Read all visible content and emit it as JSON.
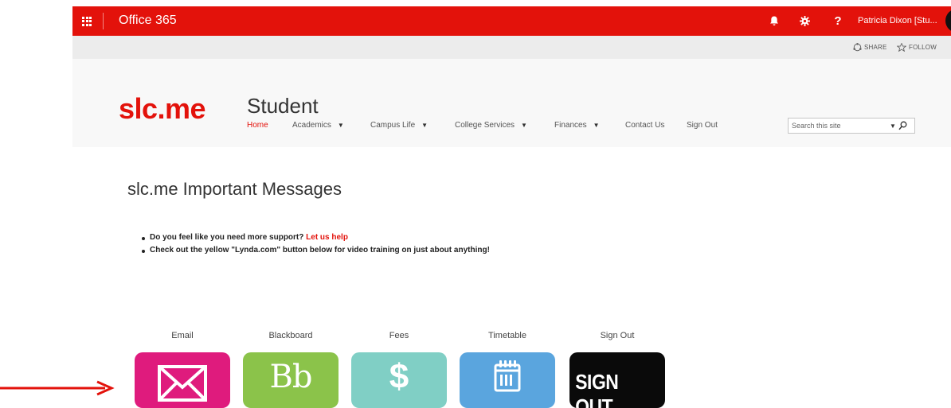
{
  "suite_bar": {
    "title": "Office 365",
    "user_name": "Patricia Dixon [Stu...",
    "help_glyph": "?"
  },
  "actions": {
    "share": "SHARE",
    "follow": "FOLLOW"
  },
  "site": {
    "logo": "slc.me",
    "title": "Student",
    "nav": [
      {
        "label": "Home",
        "active": true
      },
      {
        "label": "Academics",
        "dropdown": true
      },
      {
        "label": "Campus Life",
        "dropdown": true
      },
      {
        "label": "College Services",
        "dropdown": true
      },
      {
        "label": "Finances",
        "dropdown": true
      },
      {
        "label": "Contact Us"
      },
      {
        "label": "Sign Out"
      }
    ],
    "caret": "▼",
    "search_placeholder": "Search this site"
  },
  "content": {
    "heading": "slc.me Important Messages",
    "bullet1_text": "Do you feel like you need more support? ",
    "bullet1_link": "Let us help",
    "bullet2_text": "Check out the yellow \"Lynda.com\" button below for video training on just about anything!"
  },
  "tiles": [
    {
      "label": "Email",
      "icon": "envelope-icon"
    },
    {
      "label": "Blackboard",
      "icon_text": "Bb"
    },
    {
      "label": "Fees",
      "icon_text": "$"
    },
    {
      "label": "Timetable",
      "icon": "calendar-icon"
    },
    {
      "label": "Sign Out",
      "icon_text": "SIGN OUT"
    }
  ],
  "colors": {
    "brand_red": "#e3120b",
    "email_tile": "#df1b7d",
    "blackboard_tile": "#8bc34a",
    "fees_tile": "#80cfc5",
    "timetable_tile": "#5aa5de",
    "signout_tile": "#0a0a0a"
  }
}
